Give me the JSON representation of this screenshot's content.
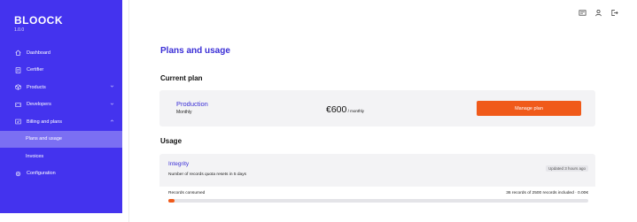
{
  "brand": {
    "name": "BLOOCK",
    "version": "1.0.0"
  },
  "sidebar": {
    "items": [
      {
        "label": "Dashboard",
        "icon": "home-icon"
      },
      {
        "label": "Certifier",
        "icon": "certificate-icon"
      },
      {
        "label": "Products",
        "icon": "products-icon",
        "expandable": true
      },
      {
        "label": "Developers",
        "icon": "code-icon",
        "expandable": true
      },
      {
        "label": "Billing and plans",
        "icon": "billing-icon",
        "expandable": true,
        "expanded": true
      },
      {
        "label": "Plans and usage",
        "sub": true,
        "active": true
      },
      {
        "label": "Invoices",
        "sub": true
      },
      {
        "label": "Configuration",
        "icon": "gear-icon"
      }
    ]
  },
  "header": {
    "icons": [
      "card-icon",
      "user-icon",
      "logout-icon"
    ]
  },
  "main": {
    "title": "Plans and usage",
    "current_plan_heading": "Current plan",
    "usage_heading": "Usage",
    "plan": {
      "name": "Production",
      "period": "Monthly",
      "price": "€600",
      "price_unit": " / monthly",
      "button": "Manage plan"
    },
    "usage": {
      "name": "Integrity",
      "description": "Number of records quota resets in 5 days",
      "updated": "Updated 3 hours ago",
      "records_label": "Records consumed",
      "records_value": "36 records of 2500 records included · 0.00€",
      "progress_fraction": 0.0144
    }
  },
  "colors": {
    "accent": "#4433ee",
    "brand_text": "#3b2fd6",
    "cta": "#f05a1a"
  }
}
